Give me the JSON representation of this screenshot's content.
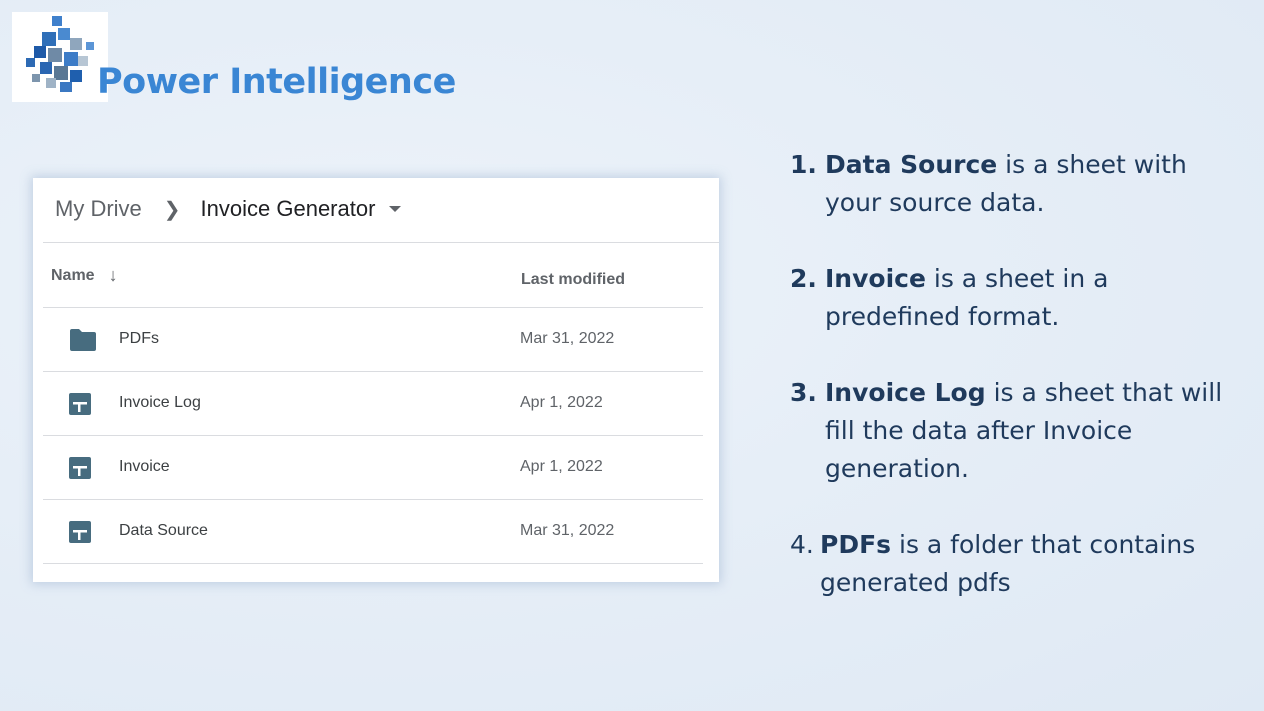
{
  "brand": {
    "title": "Power Intelligence",
    "logo_icon": "cube-logo-icon",
    "title_color": "#3a86d4"
  },
  "drive": {
    "breadcrumb": {
      "root": "My Drive",
      "separator_icon": "chevron-right-icon",
      "current": "Invoice Generator",
      "dropdown_icon": "caret-down-icon"
    },
    "columns": {
      "name": "Name",
      "sort_icon": "arrow-down-icon",
      "modified": "Last modified"
    },
    "files": [
      {
        "name": "PDFs",
        "modified": "Mar 31, 2022",
        "icon": "folder-icon"
      },
      {
        "name": "Invoice Log",
        "modified": "Apr 1, 2022",
        "icon": "sheets-icon"
      },
      {
        "name": "Invoice",
        "modified": "Apr 1, 2022",
        "icon": "sheets-icon"
      },
      {
        "name": "Data Source",
        "modified": "Mar 31, 2022",
        "icon": "sheets-icon"
      }
    ],
    "icon_color": "#476c7f"
  },
  "notes": [
    {
      "num": "1.",
      "term": "Data Source",
      "text": " is a sheet with your source data."
    },
    {
      "num": "2.",
      "term": "Invoice",
      "text": " is a sheet in a predefined format."
    },
    {
      "num": "3.",
      "term": "Invoice Log",
      "text": " is a sheet that will fill the data after Invoice generation."
    },
    {
      "num": "4.",
      "term": "PDFs",
      "text": " is a folder that contains generated pdfs"
    }
  ],
  "colors": {
    "notes_text": "#1f3a5c",
    "background": "#e6eef7"
  }
}
